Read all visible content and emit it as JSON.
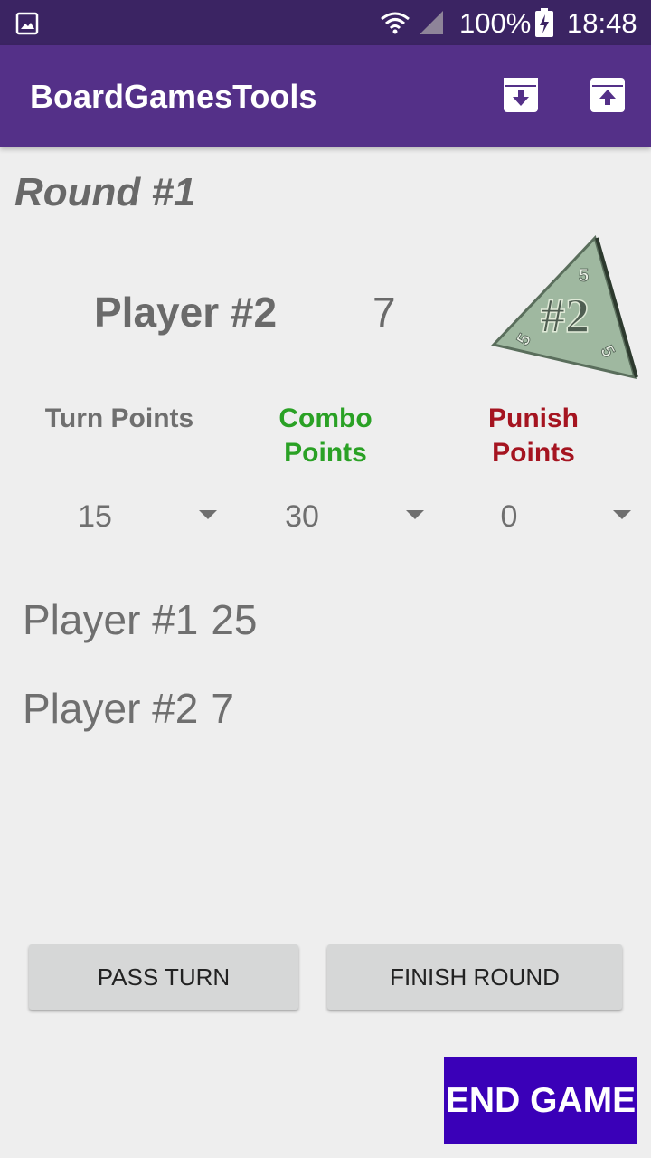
{
  "status_bar": {
    "battery_percent": "100%",
    "time": "18:48"
  },
  "app_bar": {
    "title": "BoardGamesTools",
    "icons": [
      "archive-down-icon",
      "archive-up-icon"
    ]
  },
  "round": {
    "title": "Round #1"
  },
  "current_player": {
    "name": "Player #2",
    "score": "7",
    "tile": {
      "main_label": "#2",
      "corner_labels": [
        "5",
        "5",
        "5"
      ]
    }
  },
  "points": {
    "turn": {
      "label": "Turn Points",
      "value": "15",
      "color": "#6f6f6f"
    },
    "combo": {
      "label": "Combo Points",
      "value": "30",
      "color": "#2aa125"
    },
    "punish": {
      "label": "Punish Points",
      "value": "0",
      "color": "#a51420"
    }
  },
  "scoreboard": [
    {
      "name": "Player #1",
      "score": "25"
    },
    {
      "name": "Player #2",
      "score": "7"
    }
  ],
  "buttons": {
    "pass_turn": "PASS TURN",
    "finish_round": "FINISH ROUND",
    "end_game": "END GAME"
  },
  "colors": {
    "status_bar": "#3b2463",
    "app_bar": "#543088",
    "end_game": "#3a00b8"
  }
}
